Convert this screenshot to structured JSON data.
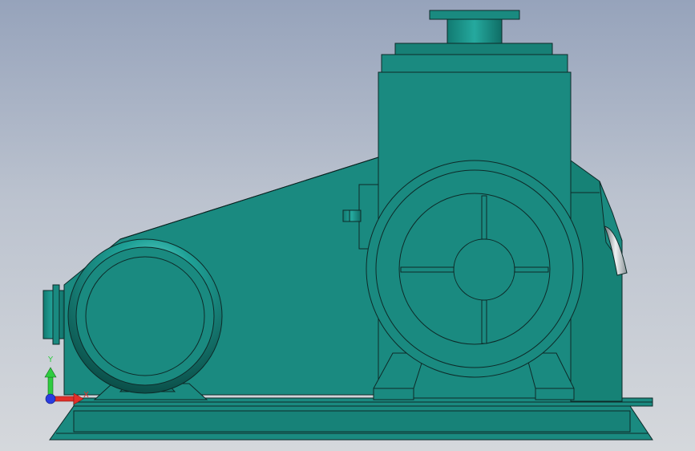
{
  "viewport": {
    "background_top": "#96a3bb",
    "background_bottom": "#d5d8dc"
  },
  "model": {
    "body_color": "#1a8a80",
    "edge_color": "#0d2a28",
    "highlight_color": "#7fe6dd",
    "shadow_color": "#0f5e57"
  },
  "triad": {
    "y_label": "Y",
    "x_label": "X",
    "y_axis_color": "#2ecc40",
    "x_axis_color": "#e0302a",
    "z_axis_color": "#2a3ce0"
  }
}
